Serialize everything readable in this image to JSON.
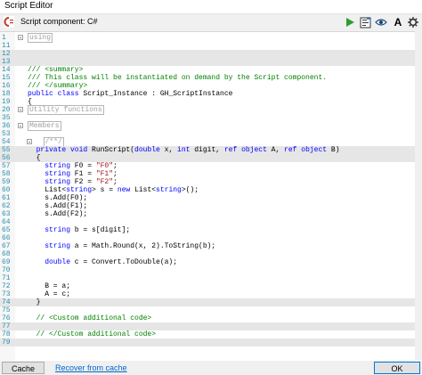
{
  "window": {
    "title": "Script Editor"
  },
  "toolbar": {
    "component_label": "Script component: C#",
    "icons": [
      "run-icon",
      "recompile-icon",
      "preview-icon",
      "font-icon",
      "settings-icon"
    ],
    "font_glyph": "A"
  },
  "colors": {
    "keyword": "#0000ff",
    "comment": "#008000",
    "string": "#a31515",
    "line_number": "#2b91af",
    "run": "#2e9d2e"
  },
  "code_lines": [
    {
      "n": "1",
      "fold": true,
      "parts": [
        {
          "t": "using",
          "c": "collapsed"
        }
      ]
    },
    {
      "n": "11",
      "parts": []
    },
    {
      "n": "12",
      "hl": true,
      "parts": []
    },
    {
      "n": "13",
      "hl": true,
      "parts": []
    },
    {
      "n": "14",
      "parts": [
        {
          "t": "/// <summary>",
          "c": "cm"
        }
      ]
    },
    {
      "n": "15",
      "parts": [
        {
          "t": "/// This class will be instantiated on demand by the Script component.",
          "c": "cm"
        }
      ]
    },
    {
      "n": "16",
      "parts": [
        {
          "t": "/// </summary>",
          "c": "cm"
        }
      ]
    },
    {
      "n": "18",
      "parts": [
        {
          "t": "public class ",
          "c": "kw"
        },
        {
          "t": "Script_Instance : GH_ScriptInstance",
          "c": "tp"
        }
      ]
    },
    {
      "n": "19",
      "parts": [
        {
          "t": "{",
          "c": "tp"
        }
      ]
    },
    {
      "n": "20",
      "fold": true,
      "parts": [
        {
          "t": "Utility functions",
          "c": "collapsed"
        }
      ]
    },
    {
      "n": "35",
      "parts": []
    },
    {
      "n": "36",
      "fold": true,
      "parts": [
        {
          "t": "Members",
          "c": "collapsed"
        }
      ]
    },
    {
      "n": "53",
      "parts": []
    },
    {
      "n": "54",
      "fold": true,
      "indent": 2,
      "parts": [
        {
          "t": "/**/",
          "c": "collapsed"
        }
      ]
    },
    {
      "n": "55",
      "hl": true,
      "indent": 2,
      "parts": [
        {
          "t": "private void ",
          "c": "kw"
        },
        {
          "t": "RunScript(",
          "c": "tp"
        },
        {
          "t": "double ",
          "c": "kw"
        },
        {
          "t": "x, ",
          "c": "tp"
        },
        {
          "t": "int ",
          "c": "kw"
        },
        {
          "t": "digit, ",
          "c": "tp"
        },
        {
          "t": "ref object ",
          "c": "kw"
        },
        {
          "t": "A, ",
          "c": "tp"
        },
        {
          "t": "ref object ",
          "c": "kw"
        },
        {
          "t": "B)",
          "c": "tp"
        }
      ]
    },
    {
      "n": "56",
      "hl": true,
      "indent": 2,
      "parts": [
        {
          "t": "{",
          "c": "tp"
        }
      ]
    },
    {
      "n": "57",
      "indent": 4,
      "parts": [
        {
          "t": "string ",
          "c": "kw"
        },
        {
          "t": "F0 = ",
          "c": "tp"
        },
        {
          "t": "\"F0\"",
          "c": "st"
        },
        {
          "t": ";",
          "c": "tp"
        }
      ]
    },
    {
      "n": "58",
      "indent": 4,
      "parts": [
        {
          "t": "string ",
          "c": "kw"
        },
        {
          "t": "F1 = ",
          "c": "tp"
        },
        {
          "t": "\"F1\"",
          "c": "st"
        },
        {
          "t": ";",
          "c": "tp"
        }
      ]
    },
    {
      "n": "59",
      "indent": 4,
      "parts": [
        {
          "t": "string ",
          "c": "kw"
        },
        {
          "t": "F2 = ",
          "c": "tp"
        },
        {
          "t": "\"F2\"",
          "c": "st"
        },
        {
          "t": ";",
          "c": "tp"
        }
      ]
    },
    {
      "n": "60",
      "indent": 4,
      "parts": [
        {
          "t": "List<",
          "c": "tp"
        },
        {
          "t": "string",
          "c": "kw"
        },
        {
          "t": "> s = ",
          "c": "tp"
        },
        {
          "t": "new ",
          "c": "kw"
        },
        {
          "t": "List<",
          "c": "tp"
        },
        {
          "t": "string",
          "c": "kw"
        },
        {
          "t": ">();",
          "c": "tp"
        }
      ]
    },
    {
      "n": "61",
      "indent": 4,
      "parts": [
        {
          "t": "s.Add(F0);",
          "c": "tp"
        }
      ]
    },
    {
      "n": "62",
      "indent": 4,
      "parts": [
        {
          "t": "s.Add(F1);",
          "c": "tp"
        }
      ]
    },
    {
      "n": "63",
      "indent": 4,
      "parts": [
        {
          "t": "s.Add(F2);",
          "c": "tp"
        }
      ]
    },
    {
      "n": "64",
      "parts": []
    },
    {
      "n": "65",
      "indent": 4,
      "parts": [
        {
          "t": "string ",
          "c": "kw"
        },
        {
          "t": "b = s[digit];",
          "c": "tp"
        }
      ]
    },
    {
      "n": "66",
      "parts": []
    },
    {
      "n": "67",
      "indent": 4,
      "parts": [
        {
          "t": "string ",
          "c": "kw"
        },
        {
          "t": "a = Math.Round(x, 2).ToString(b);",
          "c": "tp"
        }
      ]
    },
    {
      "n": "68",
      "parts": []
    },
    {
      "n": "69",
      "indent": 4,
      "parts": [
        {
          "t": "double ",
          "c": "kw"
        },
        {
          "t": "c = Convert.ToDouble(a);",
          "c": "tp"
        }
      ]
    },
    {
      "n": "70",
      "parts": []
    },
    {
      "n": "71",
      "parts": []
    },
    {
      "n": "72",
      "indent": 4,
      "parts": [
        {
          "t": "B = a;",
          "c": "tp"
        }
      ]
    },
    {
      "n": "73",
      "indent": 4,
      "parts": [
        {
          "t": "A = c;",
          "c": "tp"
        }
      ]
    },
    {
      "n": "74",
      "hl": true,
      "indent": 2,
      "parts": [
        {
          "t": "}",
          "c": "tp"
        }
      ]
    },
    {
      "n": "75",
      "parts": []
    },
    {
      "n": "76",
      "indent": 2,
      "parts": [
        {
          "t": "// <Custom additional code>",
          "c": "cm"
        }
      ]
    },
    {
      "n": "77",
      "hl": true,
      "parts": []
    },
    {
      "n": "78",
      "indent": 2,
      "parts": [
        {
          "t": "// </Custom additional code>",
          "c": "cm"
        }
      ]
    },
    {
      "n": "79",
      "hl": true,
      "parts": []
    }
  ],
  "footer": {
    "cache_label": "Cache",
    "recover_label": "Recover from cache",
    "ok_label": "OK"
  }
}
